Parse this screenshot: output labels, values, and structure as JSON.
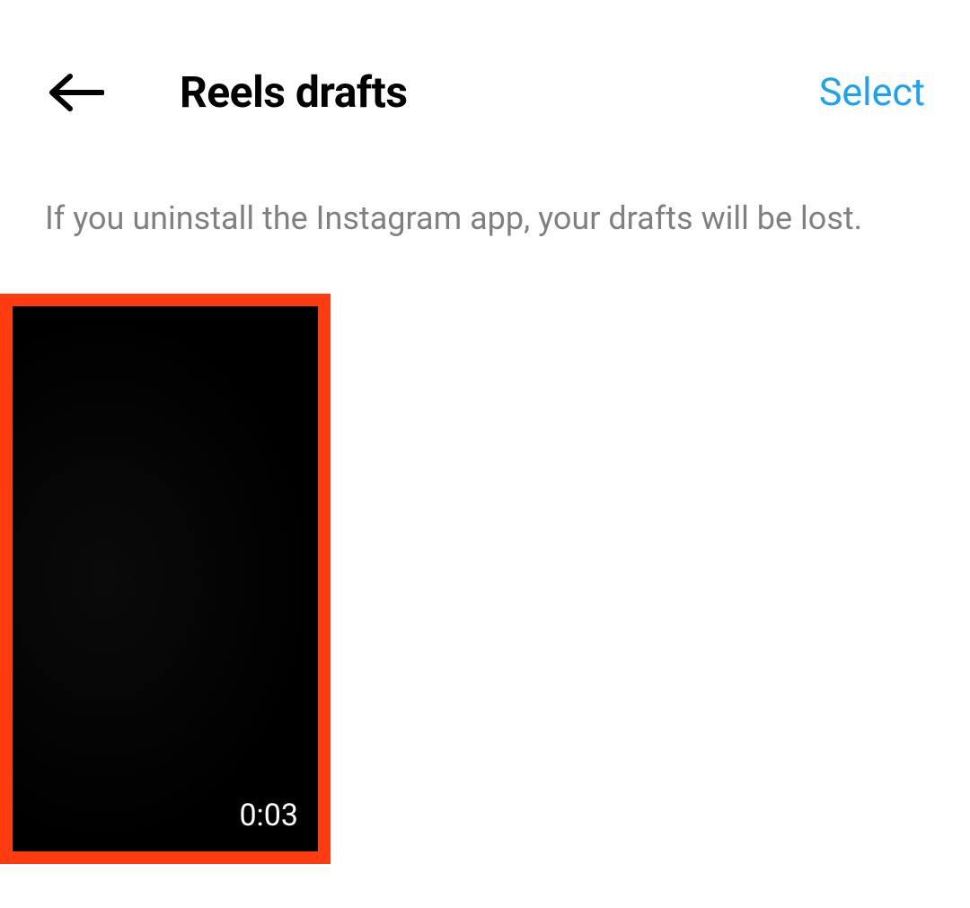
{
  "header": {
    "title": "Reels drafts",
    "select_label": "Select"
  },
  "info_message": "If you uninstall the Instagram app, your drafts will be lost.",
  "drafts": [
    {
      "duration": "0:03"
    }
  ],
  "colors": {
    "accent": "#1da1f2",
    "highlight_border": "#ff3b12"
  }
}
